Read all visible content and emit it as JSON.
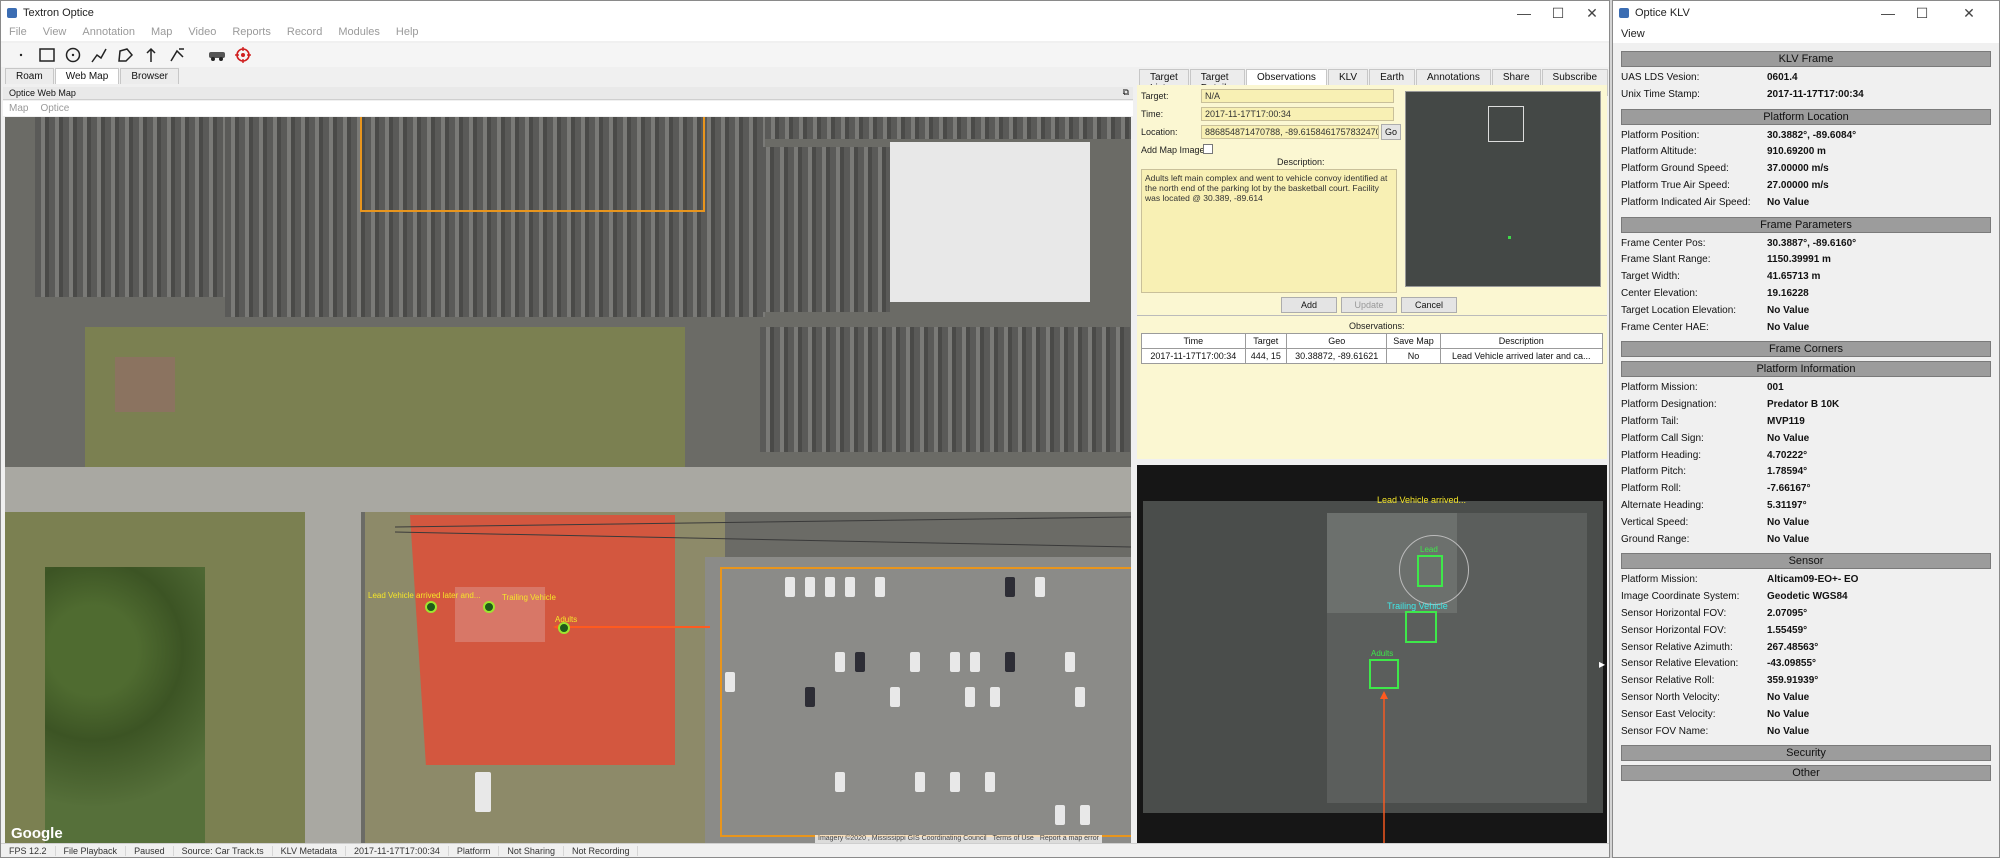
{
  "main_window": {
    "title": "Textron Optice",
    "menu": [
      "File",
      "View",
      "Annotation",
      "Map",
      "Video",
      "Reports",
      "Record",
      "Modules",
      "Help"
    ],
    "tabs": [
      "Roam",
      "Web Map",
      "Browser"
    ],
    "active_tab": "Web Map",
    "panel_title": "Optice Web Map",
    "submenu": [
      "Map",
      "Optice"
    ]
  },
  "toolbar_icons": [
    "pointer-icon",
    "rectangle-icon",
    "circle-icon",
    "polyline-icon",
    "polygon-icon",
    "arrow-icon",
    "measure-icon",
    "vehicle-icon",
    "target-icon"
  ],
  "map": {
    "google_logo": "Google",
    "labels": {
      "lead": "Lead Vehicle arrived later and...",
      "trailing": "Trailing Vehicle",
      "lead_short": "Lead",
      "adults": "Adults"
    },
    "attribution": [
      "Imagery ©2020 , Mississippi GIS Coordinating Council",
      "Terms of Use",
      "Report a map error"
    ]
  },
  "right_tabs": [
    "Target List",
    "Target Details",
    "Observations",
    "KLV",
    "Earth",
    "Annotations",
    "Share",
    "Subscribe"
  ],
  "active_right_tab": "Observations",
  "observation_form": {
    "target_label": "Target:",
    "target_value": "N/A",
    "time_label": "Time:",
    "time_value": "2017-11-17T17:00:34",
    "location_label": "Location:",
    "location_value": "886854871470788, -89.6158461757832470",
    "go": "Go",
    "add_map_image": "Add Map Image:",
    "description_label": "Description:",
    "description": "Adults left main complex and went to vehicle convoy identified at the north end of the parking lot by the basketball court.  Facility was located @ 30.389, -89.614",
    "buttons": {
      "add": "Add",
      "update": "Update",
      "cancel": "Cancel"
    },
    "observations_label": "Observations:",
    "table": {
      "headers": [
        "Time",
        "Target",
        "Geo",
        "Save Map",
        "Description"
      ],
      "rows": [
        [
          "2017-11-17T17:00:34",
          "444, 15",
          "30.38872, -89.61621",
          "No",
          "Lead Vehicle arrived later and ca..."
        ]
      ]
    }
  },
  "video_overlay": {
    "lead_caption": "Lead Vehicle arrived...",
    "lead": "Lead",
    "trailing": "Trailing Vehicle",
    "adults": "Adults"
  },
  "statusbar": [
    "FPS 12.2",
    "File Playback",
    "Paused",
    "Source: Car Track.ts",
    "KLV Metadata",
    "2017-11-17T17:00:34",
    "Platform",
    "Not Sharing",
    "Not Recording"
  ],
  "klv_window": {
    "title": "Optice KLV",
    "menu": [
      "View"
    ],
    "sections": [
      {
        "header": "KLV Frame",
        "rows": [
          [
            "UAS LDS Vesion:",
            "0601.4"
          ],
          [
            "Unix Time Stamp:",
            "2017-11-17T17:00:34"
          ]
        ]
      },
      {
        "header": "Platform Location",
        "rows": [
          [
            "Platform Position:",
            "30.3882°, -89.6084°"
          ],
          [
            "Platform Altitude:",
            "910.69200 m"
          ],
          [
            "Platform Ground Speed:",
            "37.00000 m/s"
          ],
          [
            "Platform True Air Speed:",
            "27.00000 m/s"
          ],
          [
            "Platform Indicated Air Speed:",
            "No Value"
          ]
        ]
      },
      {
        "header": "Frame Parameters",
        "rows": [
          [
            "Frame Center Pos:",
            "30.3887°, -89.6160°"
          ],
          [
            "Frame Slant Range:",
            "1150.39991 m"
          ],
          [
            "Target Width:",
            "41.65713 m"
          ],
          [
            "Center Elevation:",
            "19.16228"
          ],
          [
            "Target Location Elevation:",
            "No Value"
          ],
          [
            "Frame Center HAE:",
            "No Value"
          ]
        ]
      },
      {
        "header": "Frame Corners",
        "rows": []
      },
      {
        "header": "Platform Information",
        "rows": [
          [
            "Platform Mission:",
            "001"
          ],
          [
            "Platform Designation:",
            "Predator B 10K"
          ],
          [
            "Platform Tail:",
            "MVP119"
          ],
          [
            "Platform Call Sign:",
            "No Value"
          ],
          [
            "Platform Heading:",
            "4.70222°"
          ],
          [
            "Platform Pitch:",
            "1.78594°"
          ],
          [
            "Platform Roll:",
            "-7.66167°"
          ],
          [
            "Alternate Heading:",
            "5.31197°"
          ],
          [
            "Vertical Speed:",
            "No Value"
          ],
          [
            "Ground Range:",
            "No Value"
          ]
        ]
      },
      {
        "header": "Sensor",
        "rows": [
          [
            "Platform Mission:",
            "Alticam09-EO+- EO"
          ],
          [
            "Image Coordinate System:",
            "Geodetic WGS84"
          ],
          [
            "Sensor Horizontal FOV:",
            "2.07095°"
          ],
          [
            "Sensor Horizontal FOV:",
            "1.55459°"
          ],
          [
            "Sensor Relative Azimuth:",
            "267.48563°"
          ],
          [
            "Sensor Relative Elevation:",
            "-43.09855°"
          ],
          [
            "Sensor Relative Roll:",
            "359.91939°"
          ],
          [
            "Sensor North Velocity:",
            "No Value"
          ],
          [
            "Sensor East Velocity:",
            "No Value"
          ],
          [
            "Sensor FOV Name:",
            "No Value"
          ]
        ]
      },
      {
        "header": "Security",
        "rows": []
      },
      {
        "header": "Other",
        "rows": []
      }
    ]
  }
}
